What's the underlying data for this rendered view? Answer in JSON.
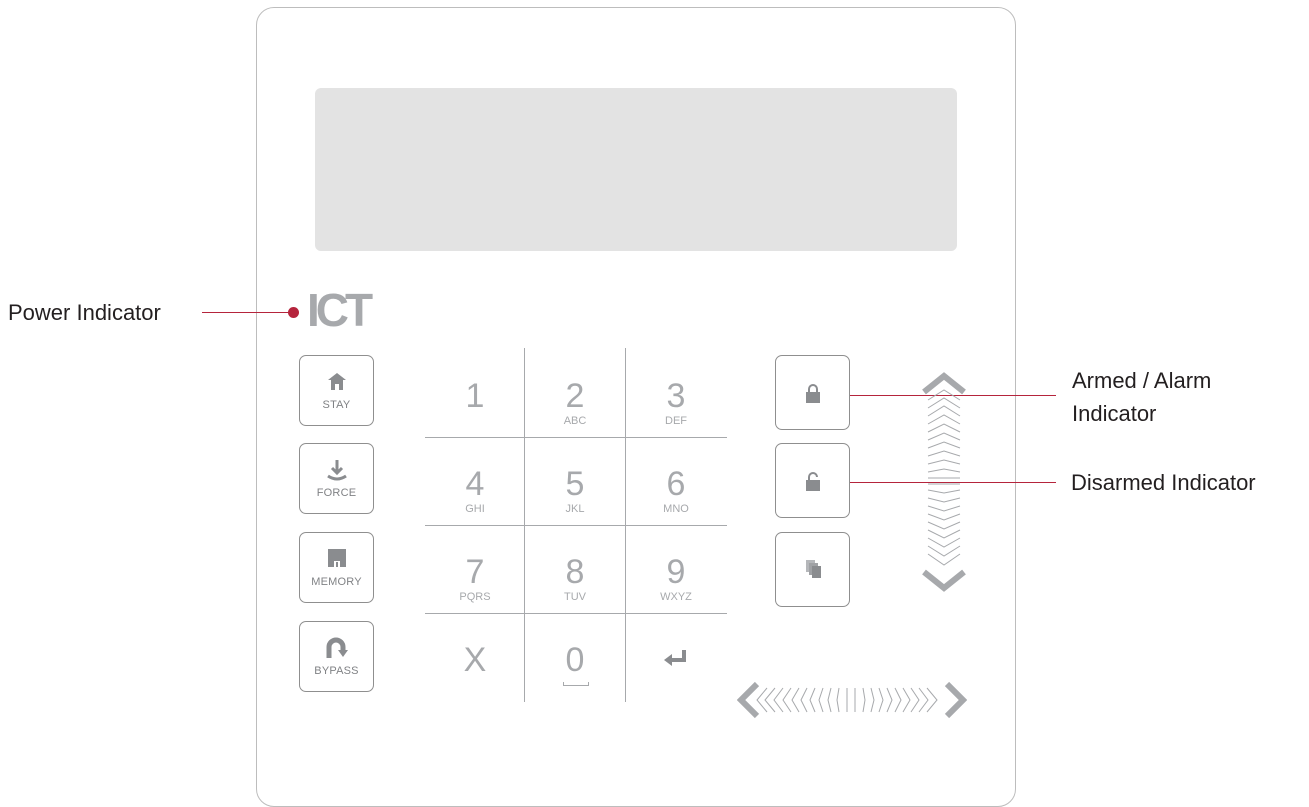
{
  "callouts": {
    "power": "Power Indicator",
    "armed_line1": "Armed / Alarm",
    "armed_line2": "Indicator",
    "disarmed": "Disarmed Indicator"
  },
  "brand": {
    "logo_text": "ICT"
  },
  "function_buttons": [
    {
      "label": "STAY",
      "icon": "house-icon"
    },
    {
      "label": "FORCE",
      "icon": "force-arrow-icon"
    },
    {
      "label": "MEMORY",
      "icon": "memory-icon"
    },
    {
      "label": "BYPASS",
      "icon": "bypass-arrow-icon"
    }
  ],
  "keypad": [
    {
      "num": "1",
      "sub": ""
    },
    {
      "num": "2",
      "sub": "ABC"
    },
    {
      "num": "3",
      "sub": "DEF"
    },
    {
      "num": "4",
      "sub": "GHI"
    },
    {
      "num": "5",
      "sub": "JKL"
    },
    {
      "num": "6",
      "sub": "MNO"
    },
    {
      "num": "7",
      "sub": "PQRS"
    },
    {
      "num": "8",
      "sub": "TUV"
    },
    {
      "num": "9",
      "sub": "WXYZ"
    },
    {
      "num": "X",
      "sub": ""
    },
    {
      "num": "0",
      "sub": ""
    },
    {
      "num": "↵",
      "sub": ""
    }
  ],
  "right_buttons": [
    {
      "icon": "lock-closed-icon"
    },
    {
      "icon": "lock-open-icon"
    },
    {
      "icon": "pages-icon"
    }
  ],
  "colors": {
    "accent": "#b5243c",
    "key_text": "#a7a9ac",
    "lcd": "#e3e3e3"
  }
}
